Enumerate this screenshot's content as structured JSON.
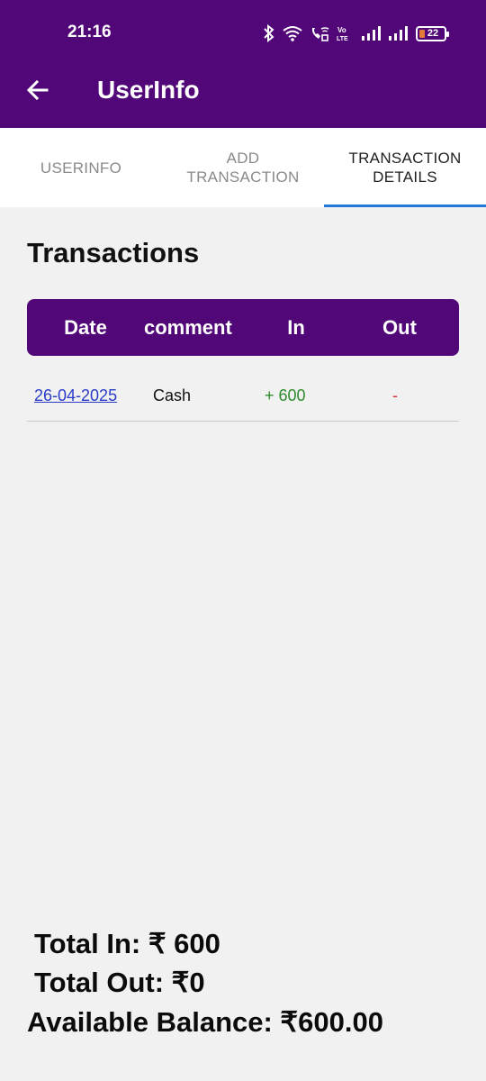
{
  "status_bar": {
    "time": "21:16",
    "battery": "22",
    "icons": [
      "bluetooth-icon",
      "wifi-icon",
      "wifi-calling-icon",
      "volte-icon",
      "signal-icon",
      "signal-icon",
      "battery-icon"
    ]
  },
  "appbar": {
    "title": "UserInfo",
    "back_icon": "arrow-left-icon",
    "color": "#520779"
  },
  "tabs": [
    {
      "label": "USERINFO",
      "active": false
    },
    {
      "label": "ADD TRANSACTION",
      "active": false
    },
    {
      "label": "TRANSACTION DETAILS",
      "active": true
    }
  ],
  "section_title": "Transactions",
  "table": {
    "headers": [
      "Date",
      "comment",
      "In",
      "Out"
    ],
    "rows": [
      {
        "date": "26-04-2025",
        "comment": "Cash",
        "in": "+ 600",
        "out": "-"
      }
    ]
  },
  "totals": {
    "total_in": "Total In: ₹ 600",
    "total_out": "Total Out: ₹0",
    "available_balance": "Available Balance: ₹600.00"
  },
  "colors": {
    "accent": "#520779",
    "tab_indicator": "#1f7ad8",
    "in_color": "#2e8b2e",
    "out_color": "#d32f2f",
    "link_color": "#2a3cc7"
  }
}
